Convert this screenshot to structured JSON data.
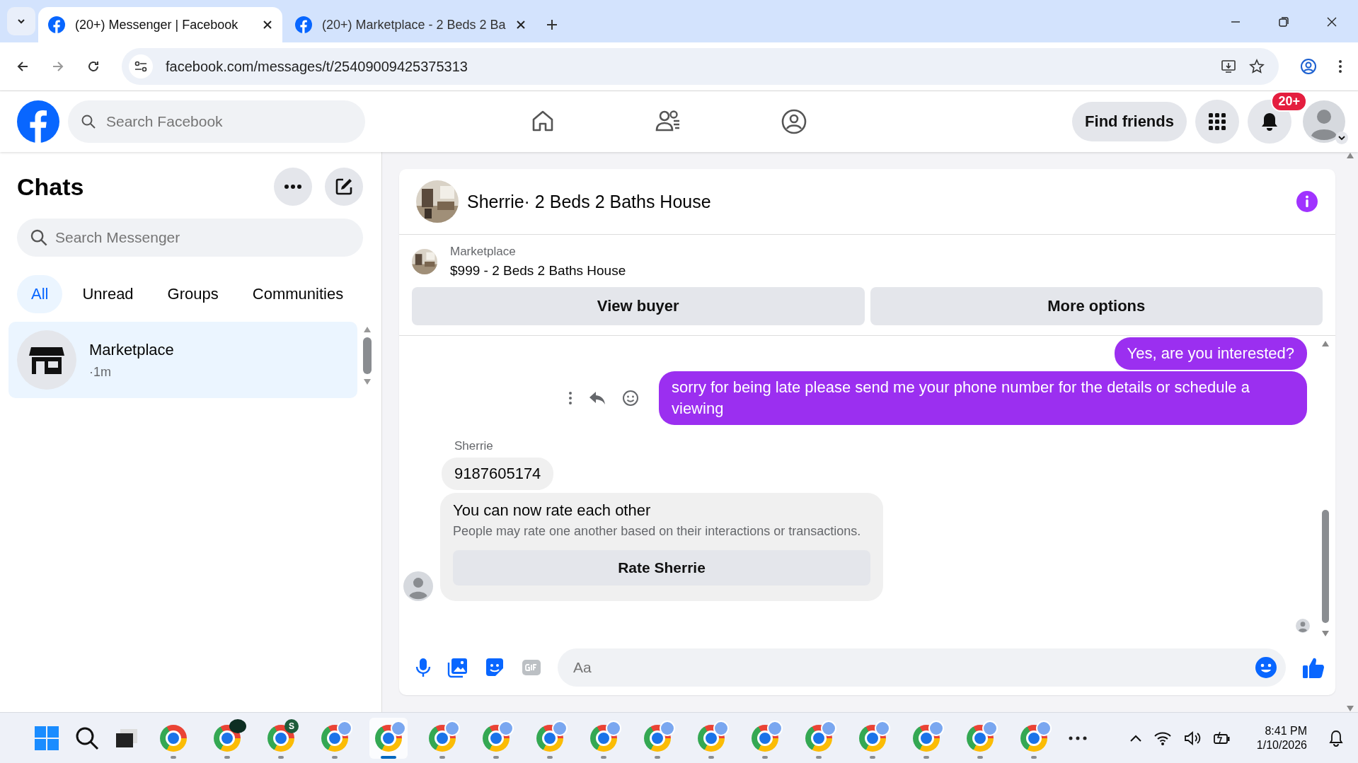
{
  "browser": {
    "tabs": [
      {
        "title": "(20+) Messenger | Facebook",
        "selected": true
      },
      {
        "title": "(20+) Marketplace - 2 Beds 2 Ba",
        "selected": false
      }
    ],
    "url": "facebook.com/messages/t/25409009425375313"
  },
  "header": {
    "search_placeholder": "Search Facebook",
    "find_friends": "Find friends",
    "notification_badge": "20+"
  },
  "chats": {
    "title": "Chats",
    "search_placeholder": "Search Messenger",
    "filters": [
      {
        "label": "All",
        "selected": true
      },
      {
        "label": "Unread",
        "selected": false
      },
      {
        "label": "Groups",
        "selected": false
      },
      {
        "label": "Communities",
        "selected": false
      }
    ],
    "items": [
      {
        "name": "Marketplace",
        "time": "·1m",
        "selected": true
      }
    ]
  },
  "conversation": {
    "title": "Sherrie· 2 Beds 2 Baths House",
    "listing": {
      "label": "Marketplace",
      "title": "$999 - 2 Beds 2 Baths House"
    },
    "actions": [
      "View buyer",
      "More options"
    ],
    "messages": [
      {
        "kind": "outgoing",
        "text": "Yes, are you interested?",
        "show_actions": false
      },
      {
        "kind": "outgoing",
        "text": "sorry for being late please send me your phone number for the details or schedule a viewing",
        "show_actions": true
      },
      {
        "kind": "sender",
        "text": "Sherrie"
      },
      {
        "kind": "incoming",
        "text": "9187605174"
      },
      {
        "kind": "rating",
        "title": "You can now rate each other",
        "body": "People may rate one another based on their interactions or transactions.",
        "button": "Rate Sherrie"
      }
    ],
    "composer_placeholder": "Aa"
  },
  "taskbar": {
    "apps": [
      {
        "kind": "start"
      },
      {
        "kind": "search"
      },
      {
        "kind": "taskview"
      },
      {
        "kind": "chrome",
        "selected": false
      },
      {
        "kind": "chrome-dark",
        "selected": false
      },
      {
        "kind": "chrome-letter",
        "badge": "S",
        "selected": false
      },
      {
        "kind": "chrome-profile",
        "selected": false
      },
      {
        "kind": "chrome-profile",
        "selected": true
      },
      {
        "kind": "chrome-profile",
        "selected": false
      },
      {
        "kind": "chrome-profile",
        "selected": false
      },
      {
        "kind": "chrome-profile",
        "selected": false
      },
      {
        "kind": "chrome-profile",
        "selected": false
      },
      {
        "kind": "chrome-profile",
        "selected": false
      },
      {
        "kind": "chrome-profile",
        "selected": false
      },
      {
        "kind": "chrome-profile",
        "selected": false
      },
      {
        "kind": "chrome-profile",
        "selected": false
      },
      {
        "kind": "chrome-profile",
        "selected": false
      },
      {
        "kind": "chrome-profile",
        "selected": false
      },
      {
        "kind": "chrome-profile",
        "selected": false
      },
      {
        "kind": "chrome-profile",
        "selected": false
      },
      {
        "kind": "more"
      }
    ],
    "time": "8:41 PM",
    "date": "1/10/2026"
  }
}
